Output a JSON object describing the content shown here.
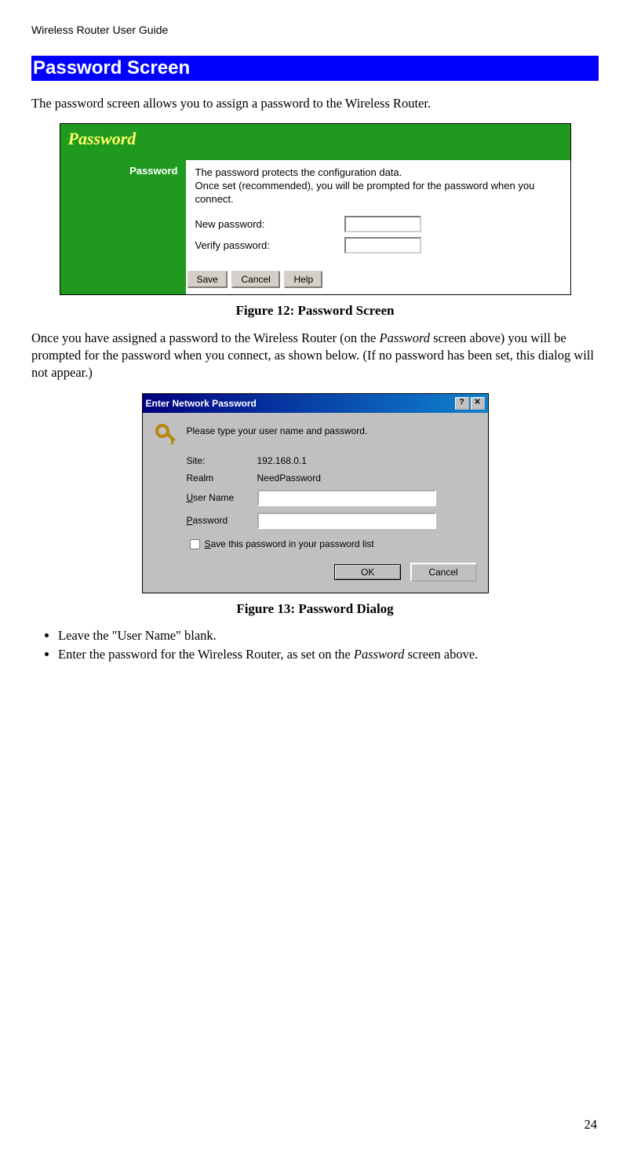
{
  "runningHeader": "Wireless Router User Guide",
  "sectionHeading": "Password Screen",
  "intro": "The password screen allows you to assign a password to the Wireless Router.",
  "fig12": {
    "title": "Password",
    "sideLabel": "Password",
    "desc1": "The password protects the configuration data.",
    "desc2": "Once set (recommended), you will be prompted for the password when you connect.",
    "newPwLabel": "New password:",
    "verifyPwLabel": "Verify password:",
    "saveBtn": "Save",
    "cancelBtn": "Cancel",
    "helpBtn": "Help",
    "caption": "Figure 12: Password Screen"
  },
  "para2a": "Once you have assigned a password to the Wireless Router (on the ",
  "para2b": "Password",
  "para2c": " screen above) you will be prompted for the password when you connect, as shown below. (If no password has been set, this dialog will not appear.)",
  "fig13": {
    "title": "Enter Network Password",
    "helpGlyph": "?",
    "closeGlyph": "✕",
    "prompt": "Please type your user name and password.",
    "siteLabel": "Site:",
    "siteValue": "192.168.0.1",
    "realmLabel": "Realm",
    "realmValue": "NeedPassword",
    "userLabel_pre": "U",
    "userLabel_post": "ser Name",
    "passLabel_pre": "P",
    "passLabel_post": "assword",
    "saveChk_pre": "S",
    "saveChk_post": "ave this password in your password list",
    "okBtn": "OK",
    "cancelBtn": "Cancel",
    "caption": "Figure 13: Password Dialog"
  },
  "bullets": {
    "b1": "Leave the \"User Name\" blank.",
    "b2a": "Enter the password for the Wireless Router, as set on the ",
    "b2b": "Password",
    "b2c": " screen above."
  },
  "pageNumber": "24"
}
